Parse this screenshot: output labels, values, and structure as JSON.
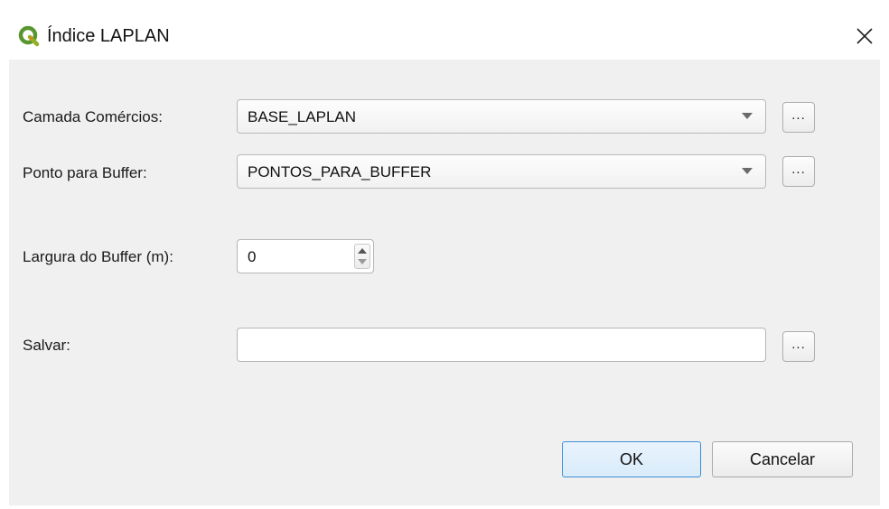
{
  "window": {
    "title": "Índice LAPLAN",
    "icon": "qgis-logo-icon",
    "close_icon": "close-icon"
  },
  "form": {
    "camada_comercios": {
      "label": "Camada Comércios:",
      "value": "BASE_LAPLAN",
      "browse_label": "..."
    },
    "ponto_buffer": {
      "label": "Ponto para Buffer:",
      "value": "PONTOS_PARA_BUFFER",
      "browse_label": "..."
    },
    "largura_buffer": {
      "label": "Largura do Buffer (m):",
      "value": "0"
    },
    "salvar": {
      "label": "Salvar:",
      "value": "",
      "browse_label": "..."
    }
  },
  "buttons": {
    "ok_label": "OK",
    "cancel_label": "Cancelar"
  },
  "colors": {
    "dialog_background": "#f0f0f0",
    "accent_border": "#3c8fd8",
    "qgis_green": "#589632",
    "qgis_yellow": "#ee7913"
  }
}
